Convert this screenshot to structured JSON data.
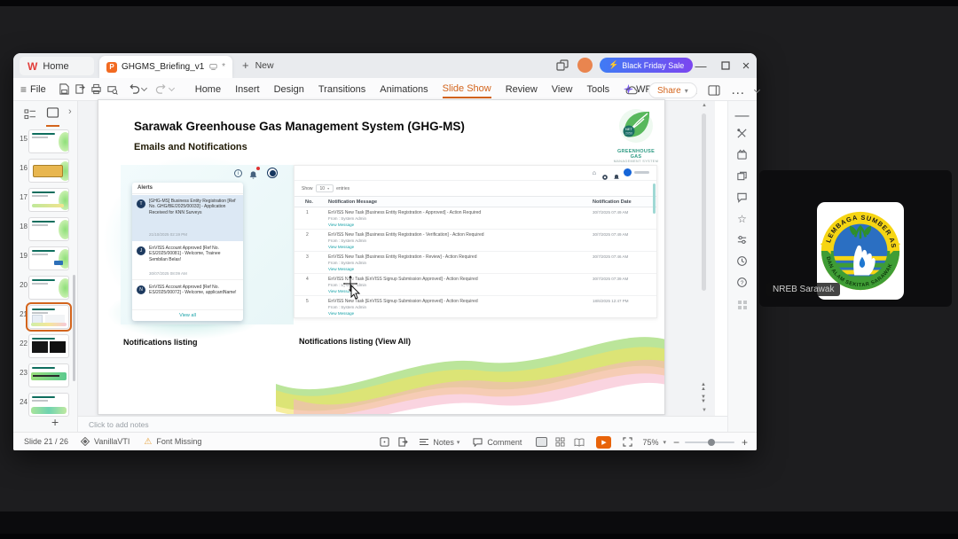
{
  "meeting": {
    "participant": "NREB Sarawak",
    "logo_top_text": "LEMBAGA SUMBER ASLI",
    "logo_bottom_text": "DAN ALAM SEKITAR SARAWAK"
  },
  "titlebar": {
    "home_tab": "Home",
    "doc_tab": "GHGMS_Briefing_v1.pptx",
    "modified_mark": "*",
    "new_tab": "New",
    "promo": "Black Friday Sale"
  },
  "menubar": {
    "file": "File",
    "items": [
      "Home",
      "Insert",
      "Design",
      "Transitions",
      "Animations",
      "Slide Show",
      "Review",
      "View",
      "Tools",
      "WPS AI"
    ],
    "share": "Share"
  },
  "thumbnails": {
    "numbers": [
      "15",
      "16",
      "17",
      "18",
      "19",
      "20",
      "21",
      "22",
      "23",
      "24"
    ],
    "selected": "21"
  },
  "slide": {
    "title": "Sarawak Greenhouse Gas Management System (GHG-MS)",
    "subtitle": "Emails and Notifications",
    "brand": {
      "badge": "NET ZERO 2050",
      "line1": "GREENHOUSE GAS",
      "line2": "MANAGEMENT SYSTEM"
    },
    "caption_left": "Notifications listing",
    "caption_right": "Notifications listing (View All)",
    "alerts": {
      "header": "Alerts",
      "view_all": "View all",
      "items": [
        {
          "avatar": "T",
          "text": "[GHG-MS] Business Entity Registration [Ref No. GHG/BE/2025/00033] - Application Received for KNN Surveys",
          "date": "21/10/2025 02:19 PM"
        },
        {
          "avatar": "J",
          "text": "EnVISS Account Approved [Ref No. ES/2025/00081] - Welcome, Trainee Sembilan Belas!",
          "date": "30/07/2025 08:09 AM"
        },
        {
          "avatar": "N",
          "text": "EnVISS Account Approved [Ref No. ES/2025/00072] - Welcome, applicantName!",
          "date": ""
        }
      ]
    },
    "portal": {
      "show": "Show",
      "show_value": "10",
      "entries": "entries",
      "col_no": "No.",
      "col_msg": "Notification Message",
      "col_date": "Notification Date",
      "rows": [
        {
          "no": "1",
          "msg": "EnVISS New Task [Business Entity Registration - Approved] - Action Required",
          "from": "From : System Admin",
          "link": "View Message",
          "date": "30/7/2025 07:49 AM"
        },
        {
          "no": "2",
          "msg": "EnVISS New Task [Business Entity Registration - Verification] - Action Required",
          "from": "From : System Admin",
          "link": "View Message",
          "date": "30/7/2025 07:49 AM"
        },
        {
          "no": "3",
          "msg": "EnVISS New Task [Business Entity Registration - Review] - Action Required",
          "from": "From : System Admin",
          "link": "View Message",
          "date": "30/7/2025 07:46 AM"
        },
        {
          "no": "4",
          "msg": "EnVISS New Task [EnVISS Signup Submission Approved] - Action Required",
          "from": "From : System Admin",
          "link": "View Message",
          "date": "30/7/2025 07:39 AM"
        },
        {
          "no": "5",
          "msg": "EnVISS New Task [EnVISS Signup Submission Approved] - Action Required",
          "from": "From : System Admin",
          "link": "View Message",
          "date": "18/6/2025 12:47 PM"
        }
      ]
    },
    "notes_placeholder": "Click to add notes"
  },
  "statusbar": {
    "slide_indicator": "Slide 21 / 26",
    "theme": "VanillaVTI",
    "warning": "Font Missing",
    "notes": "Notes",
    "comment": "Comment",
    "zoom": "75%"
  }
}
